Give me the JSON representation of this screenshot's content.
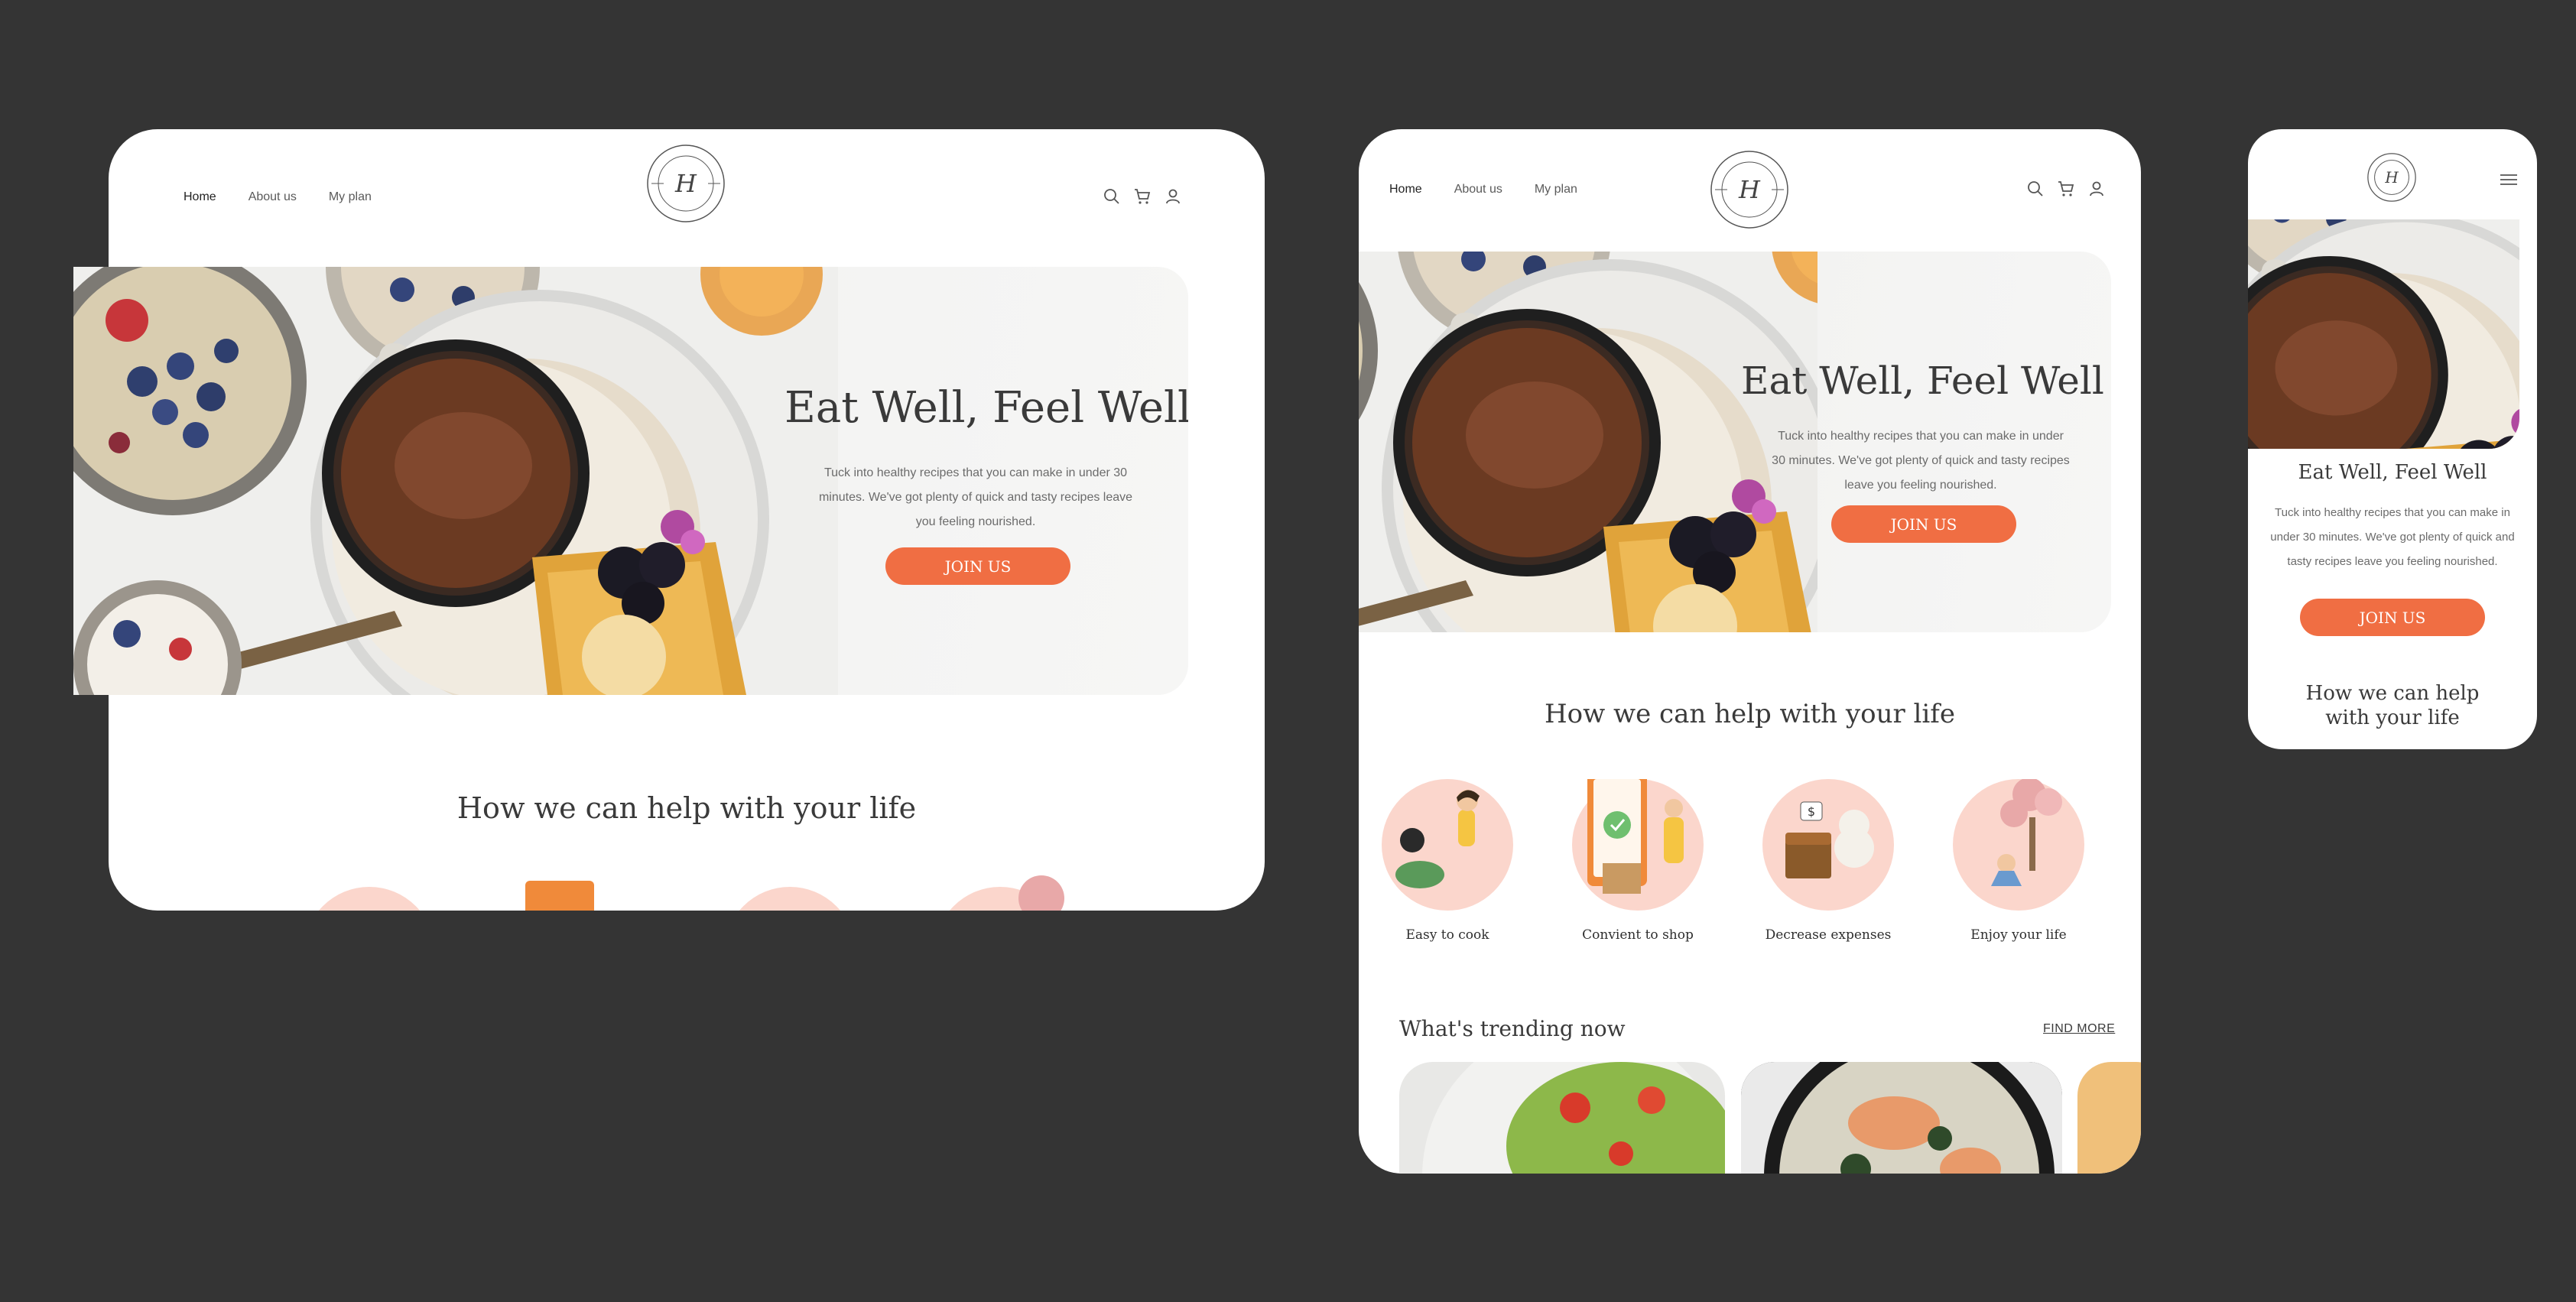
{
  "nav": {
    "home": "Home",
    "about": "About us",
    "plan": "My plan"
  },
  "icons": {
    "search": "search-icon",
    "cart": "cart-icon",
    "user": "user-icon",
    "menu": "hamburger-menu-icon",
    "logo": "monogram-logo-H"
  },
  "hero": {
    "title": "Eat Well, Feel Well",
    "text": "Tuck into healthy recipes that you can make in under 30 minutes. We've got plenty of quick and tasty recipes leave you feeling nourished.",
    "button": "JOIN US"
  },
  "help": {
    "title": "How we can help with your life",
    "items": [
      {
        "label": "Easy to cook"
      },
      {
        "label": "Convient to shop"
      },
      {
        "label": "Decrease expenses"
      },
      {
        "label": "Enjoy your life"
      }
    ]
  },
  "trending": {
    "title": "What's trending now",
    "link": "FIND MORE"
  },
  "colors": {
    "background": "#343434",
    "accent": "#f06e43",
    "feature_circle": "#fbd6cc"
  }
}
